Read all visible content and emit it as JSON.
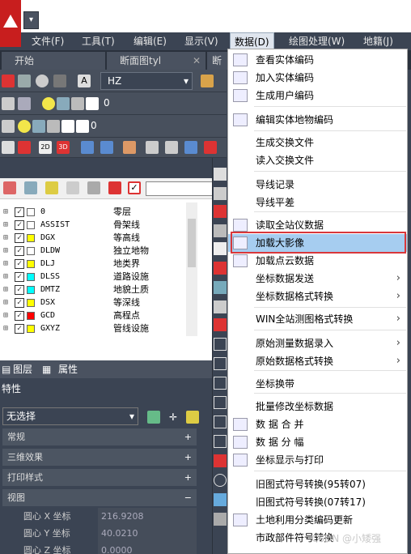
{
  "colors": {
    "accent_red": "#d9373a",
    "highlight": "#a6cdf0",
    "dark_bg": "#3b4453"
  },
  "menubar": {
    "items": [
      "文件(F)",
      "工具(T)",
      "编辑(E)",
      "显示(V)",
      "数据(D)",
      "绘图处理(W)",
      "地籍(J)"
    ]
  },
  "tabs": {
    "start": "开始",
    "doc1": "断面图tyl",
    "doc2": "断"
  },
  "toolbar": {
    "text_style": "HZ",
    "layer_value_1": "0",
    "layer_value_2": "0"
  },
  "layers": [
    {
      "name": "0",
      "desc": "零层",
      "color": "#ffffff"
    },
    {
      "name": "ASSIST",
      "desc": "骨架线",
      "color": "#ffffff"
    },
    {
      "name": "DGX",
      "desc": "等高线",
      "color": "#ffff00"
    },
    {
      "name": "DLDW",
      "desc": "独立地物",
      "color": "#ffffff"
    },
    {
      "name": "DLJ",
      "desc": "地类界",
      "color": "#ffff00"
    },
    {
      "name": "DLSS",
      "desc": "道路设施",
      "color": "#00ffff"
    },
    {
      "name": "DMTZ",
      "desc": "地貌土质",
      "color": "#00ffff"
    },
    {
      "name": "DSX",
      "desc": "等深线",
      "color": "#ffff00"
    },
    {
      "name": "GCD",
      "desc": "高程点",
      "color": "#ff0000"
    },
    {
      "name": "GXYZ",
      "desc": "管线设施",
      "color": "#ffff00"
    }
  ],
  "palette_tabs": {
    "layers": "图层",
    "properties": "属性"
  },
  "properties": {
    "title": "特性",
    "selection": "无选择",
    "sections": [
      "常规",
      "三维效果",
      "打印样式",
      "视图"
    ],
    "rows": [
      {
        "key": "圆心 X 坐标",
        "value": "216.9208"
      },
      {
        "key": "圆心 Y 坐标",
        "value": "40.0210"
      },
      {
        "key": "圆心 Z 坐标",
        "value": "0.0000"
      }
    ]
  },
  "dropdown": {
    "items": [
      {
        "label": "查看实体编码",
        "icon": "code-view-icon"
      },
      {
        "label": "加入实体编码",
        "icon": "code-add-icon"
      },
      {
        "label": "生成用户编码",
        "icon": "code-gen-icon"
      },
      {
        "label": "编辑实体地物编码",
        "icon": "code-edit-icon"
      },
      {
        "label": "生成交换文件",
        "icon": ""
      },
      {
        "label": "读入交换文件",
        "icon": ""
      },
      {
        "label": "导线记录",
        "icon": ""
      },
      {
        "label": "导线平差",
        "icon": ""
      },
      {
        "label": "读取全站仪数据",
        "icon": "total-station-icon"
      },
      {
        "label": "加载大影像",
        "icon": "image-load-icon"
      },
      {
        "label": "加载点云数据",
        "icon": "point-cloud-icon"
      },
      {
        "label": "坐标数据发送",
        "icon": ""
      },
      {
        "label": "坐标数据格式转换",
        "icon": ""
      },
      {
        "label": "WIN全站测图格式转换",
        "icon": ""
      },
      {
        "label": "原始测量数据录入",
        "icon": ""
      },
      {
        "label": "原始数据格式转换",
        "icon": ""
      },
      {
        "label": "坐标换带",
        "icon": ""
      },
      {
        "label": "批量修改坐标数据",
        "icon": ""
      },
      {
        "label": "数 据 合 并",
        "icon": "merge-icon"
      },
      {
        "label": "数 据 分 幅",
        "icon": "split-icon"
      },
      {
        "label": "坐标显示与打印",
        "icon": "print-coords-icon"
      },
      {
        "label": "旧图式符号转换(95转07)",
        "icon": ""
      },
      {
        "label": "旧图式符号转换(07转17)",
        "icon": ""
      },
      {
        "label": "土地利用分类编码更新",
        "icon": "landuse-icon"
      },
      {
        "label": "市政部件符号转换",
        "icon": ""
      }
    ]
  },
  "watermark": "CSDN @小矮强"
}
